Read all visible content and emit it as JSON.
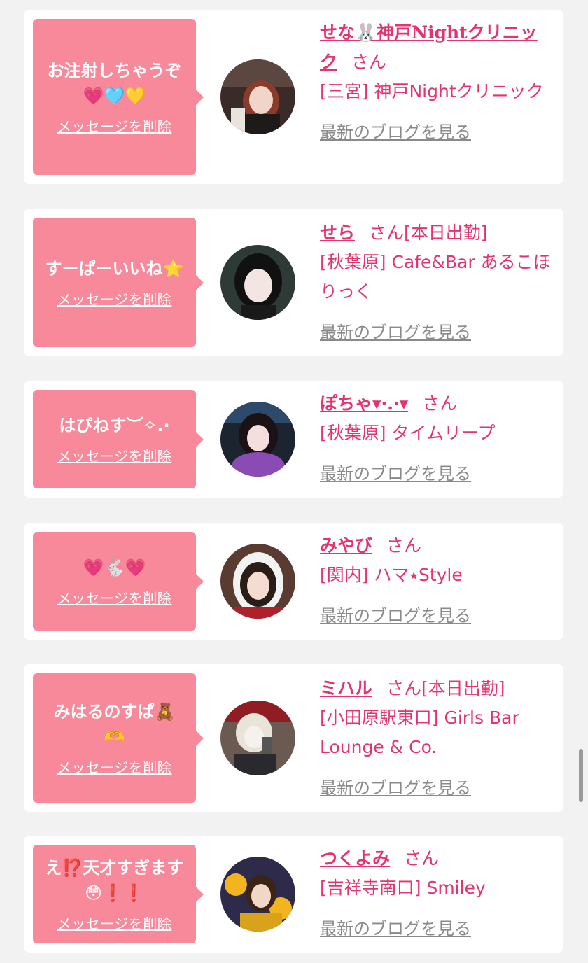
{
  "delete_label": "メッセージを削除",
  "blog_label": "最新のブログを見る",
  "san": "さん",
  "colors": {
    "bubble": "#f7899a",
    "accent": "#e4336f",
    "link_gray": "#8a8a8a",
    "card_bg": "#ffffff",
    "page_bg": "#f2f2f2"
  },
  "items": [
    {
      "message": "お注射しちゃうぞ\n💗🩵💛",
      "name": "せな🐰神戸Nightクリニック",
      "status": "",
      "shop": "[三宮] 神戸Nightクリニック",
      "avatar": "avatar-photo-1"
    },
    {
      "message": "すーぱーいいね⭐️",
      "name": "せら",
      "status": "[本日出勤]",
      "shop": "[秋葉原] Cafe&Bar あるこほりっく",
      "avatar": "avatar-photo-2"
    },
    {
      "message": "はぴねす︶✧.·",
      "name": "ぽちゃ▾·.·▾",
      "status": "",
      "shop": "[秋葉原] タイムリープ",
      "avatar": "avatar-photo-3"
    },
    {
      "message": "💗🐇💗",
      "name": "みやび",
      "status": "",
      "shop": "[関内] ハマ⭑Style",
      "avatar": "avatar-photo-4"
    },
    {
      "message": "みはるのすぱ🧸\n🫶",
      "name": "ミハル",
      "status": "[本日出勤]",
      "shop": "[小田原駅東口] Girls Bar Lounge & Co.",
      "avatar": "avatar-photo-5"
    },
    {
      "message": "え⁉️天才すぎます\n😳❗️❗️",
      "name": "つくよみ",
      "status": "",
      "shop": "[吉祥寺南口] Smiley",
      "avatar": "avatar-photo-6"
    }
  ]
}
